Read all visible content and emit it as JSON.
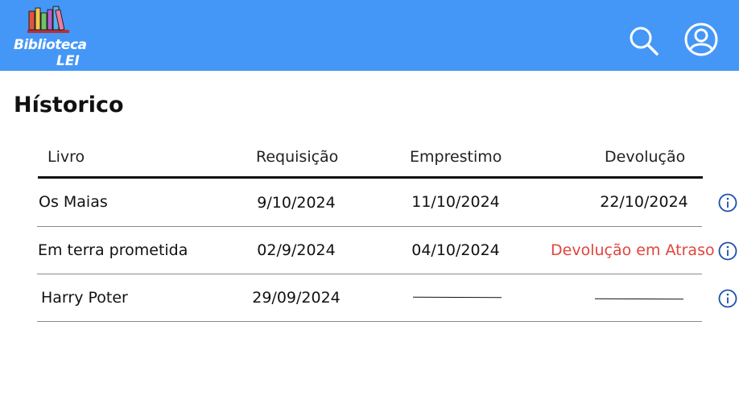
{
  "app": {
    "logo_line1": "Biblioteca",
    "logo_line2": "LEI"
  },
  "header": {
    "search_icon": "search-icon",
    "account_icon": "user-account-icon"
  },
  "page": {
    "title": "Hístorico"
  },
  "table": {
    "columns": [
      "Livro",
      "Requisição",
      "Emprestimo",
      "Devolução"
    ],
    "rows": [
      {
        "livro": "Os Maias",
        "requisicao": "9/10/2024",
        "emprestimo": "11/10/2024",
        "devolucao": "22/10/2024",
        "devolucao_status": "normal"
      },
      {
        "livro": "Em terra prometida",
        "requisicao": "02/9/2024",
        "emprestimo": "04/10/2024",
        "devolucao": "Devolução em Atraso",
        "devolucao_status": "late"
      },
      {
        "livro": "Harry Poter",
        "requisicao": "29/09/2024",
        "emprestimo": "",
        "devolucao": "",
        "devolucao_status": "empty"
      }
    ]
  },
  "colors": {
    "header_bg": "#4497f6",
    "late_text": "#e0453d",
    "info_icon": "#1f4fa8"
  }
}
